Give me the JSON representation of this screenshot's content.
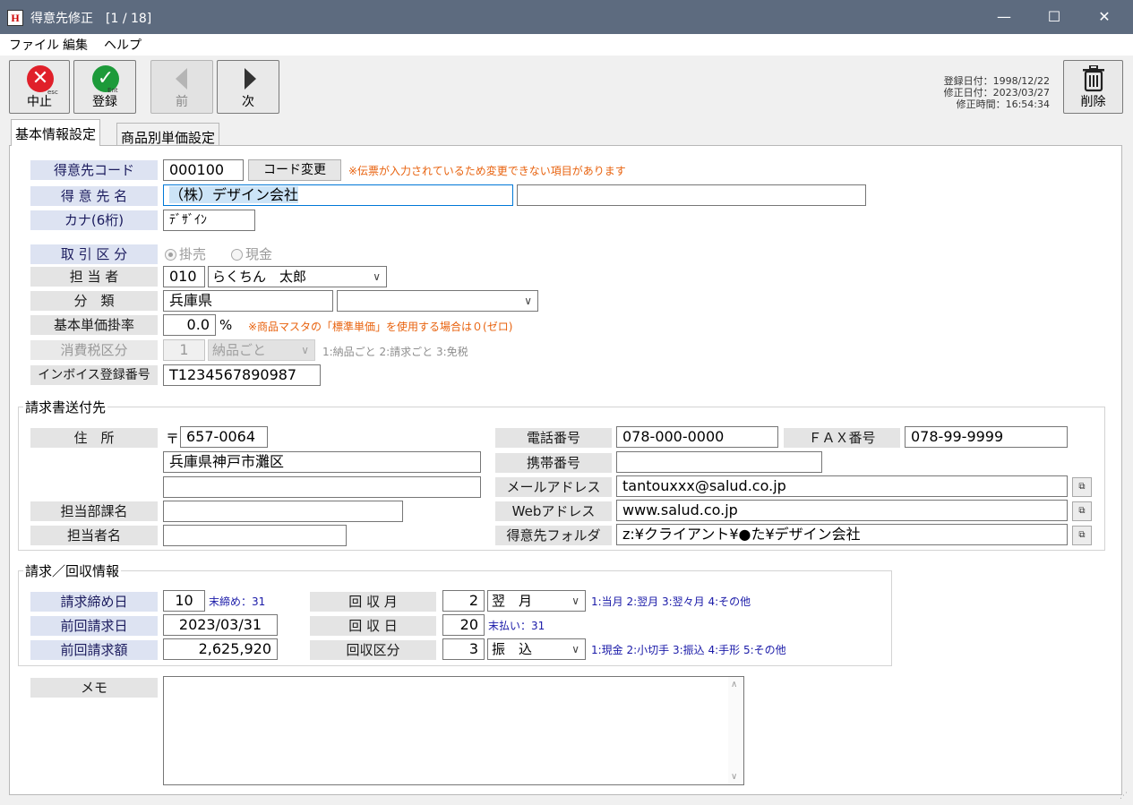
{
  "window": {
    "title": "得意先修正　[1 / 18]",
    "app_icon": "H",
    "minimize": "—",
    "maximize": "☐",
    "close": "✕"
  },
  "menu": [
    "ファイル",
    "編集",
    "ヘルプ"
  ],
  "toolbar": {
    "cancel_label": "中止",
    "cancel_key": "esc",
    "register_label": "登録",
    "register_key": "Ent",
    "prev_label": "前",
    "next_label": "次",
    "delete_label": "削除",
    "registered_date": "登録日付：1998/12/22",
    "modified_date": "修正日付：2023/03/27",
    "modified_time": "修正時間：16:54:34"
  },
  "tabs": [
    "基本情報設定",
    "商品別単価設定"
  ],
  "form": {
    "code_label": "得意先コード",
    "code_value": "000100",
    "code_change_button": "コード変更",
    "code_note": "※伝票が入力されているため変更できない項目があります",
    "name_label": "得 意 先 名",
    "name_value": "（株）デザイン会社",
    "name_value2": "",
    "kana_label": "カナ(6桁)",
    "kana_value": "ﾃﾞｻﾞｲﾝ",
    "trade_label": "取 引 区 分",
    "trade_option1": "掛売",
    "trade_option2": "現金",
    "staff_label": "担 当 者",
    "staff_code": "010",
    "staff_name": "らくちん　太郎",
    "category_label": "分　類",
    "category_value": "兵庫県",
    "category_select": "",
    "rate_label": "基本単価掛率",
    "rate_value": "0.0",
    "rate_unit": "%",
    "rate_note": "※商品マスタの「標準単価」を使用する場合は０(ゼロ)",
    "tax_label": "消費税区分",
    "tax_code": "1",
    "tax_select": "納品ごと",
    "tax_note": "1:納品ごと  2:請求ごと  3:免税",
    "invoice_label": "インボイス登録番号",
    "invoice_value": "T1234567890987"
  },
  "billing": {
    "title": "請求書送付先",
    "address_label": "住　所",
    "postal_mark": "〒",
    "postal_code": "657-0064",
    "address1": "兵庫県神戸市灘区",
    "address2": "",
    "dept_label": "担当部課名",
    "dept_value": "",
    "person_label": "担当者名",
    "person_value": "",
    "tel_label": "電話番号",
    "tel_value": "078-000-0000",
    "fax_label": "ＦＡＸ番号",
    "fax_value": "078-99-9999",
    "mobile_label": "携帯番号",
    "mobile_value": "",
    "mail_label": "メールアドレス",
    "mail_value": "tantouxxx@salud.co.jp",
    "web_label": "Webアドレス",
    "web_value": "www.salud.co.jp",
    "folder_label": "得意先フォルダ",
    "folder_value": "z:¥クライアント¥●た¥デザイン会社"
  },
  "collection": {
    "title": "請求／回収情報",
    "closing_label": "請求締め日",
    "closing_value": "10",
    "closing_note": "末締め：31",
    "last_bill_date_label": "前回請求日",
    "last_bill_date_value": "2023/03/31",
    "last_bill_amount_label": "前回請求額",
    "last_bill_amount_value": "2,625,920",
    "month_label": "回 収 月",
    "month_code": "2",
    "month_select": "翌　月",
    "month_note": "1:当月  2:翌月  3:翌々月  4:その他",
    "day_label": "回 収 日",
    "day_value": "20",
    "day_note": "末払い：31",
    "method_label": "回収区分",
    "method_code": "3",
    "method_select": "振　込",
    "method_note": "1:現金  2:小切手  3:振込  4:手形  5:その他"
  },
  "memo": {
    "label": "メモ",
    "value": ""
  }
}
